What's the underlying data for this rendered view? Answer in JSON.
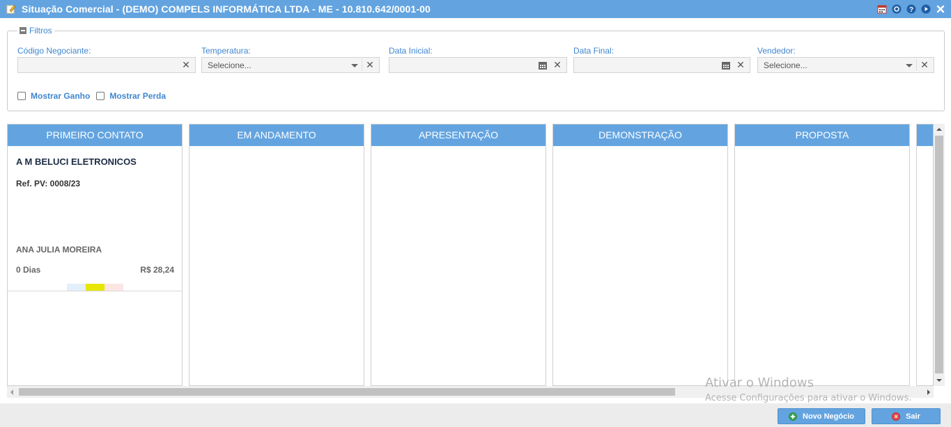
{
  "window": {
    "title": "Situação Comercial - (DEMO) COMPELS INFORMÁTICA LTDA - ME - 10.810.642/0001-00",
    "icons": [
      "edit-icon",
      "calendar-icon",
      "settings-icon",
      "help-icon",
      "play-icon",
      "close-icon"
    ]
  },
  "filters": {
    "legend": "Filtros",
    "fields": [
      {
        "label": "Código Negociante:",
        "value": "",
        "type": "text"
      },
      {
        "label": "Temperatura:",
        "value": "Selecione...",
        "type": "select"
      },
      {
        "label": "Data Inicial:",
        "value": "",
        "type": "date"
      },
      {
        "label": "Data Final:",
        "value": "",
        "type": "date"
      },
      {
        "label": "Vendedor:",
        "value": "Selecione...",
        "type": "select"
      }
    ],
    "checkboxes": [
      {
        "label": "Mostrar Ganho",
        "checked": false
      },
      {
        "label": "Mostrar Perda",
        "checked": false
      }
    ]
  },
  "board": {
    "columns": [
      {
        "title": "PRIMEIRO CONTATO"
      },
      {
        "title": "EM ANDAMENTO"
      },
      {
        "title": "APRESENTAÇÃO"
      },
      {
        "title": "DEMONSTRAÇÃO"
      },
      {
        "title": "PROPOSTA"
      }
    ],
    "card": {
      "company": "A M BELUCI ELETRONICOS",
      "ref": "Ref. PV: 0008/23",
      "person": "ANA JULIA MOREIRA",
      "days": "0 Dias",
      "value": "R$ 28,24",
      "temperature_colors": [
        "#e3effa",
        "#e6e600",
        "#fbe5e5"
      ]
    }
  },
  "watermark": {
    "line1": "Ativar o Windows",
    "line2": "Acesse Configurações para ativar o Windows."
  },
  "footer": {
    "new_label": "Novo Negócio",
    "exit_label": "Sair"
  }
}
